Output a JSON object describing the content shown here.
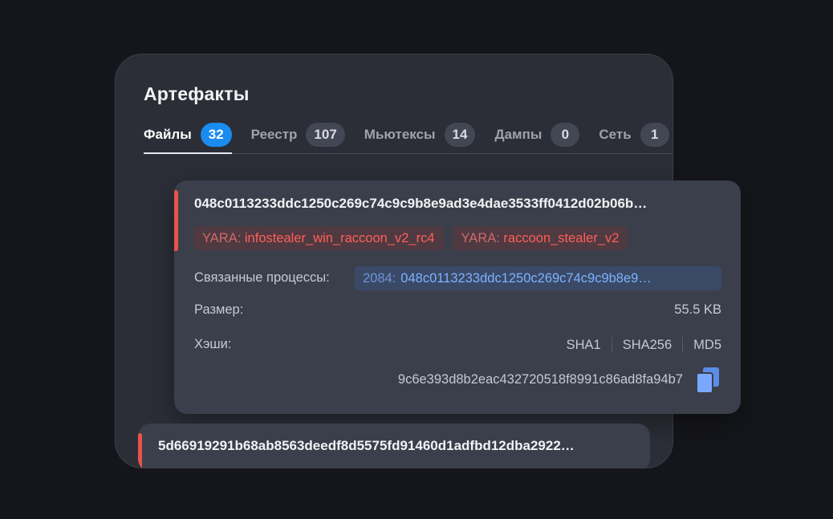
{
  "panel": {
    "title": "Артефакты",
    "tabs": [
      {
        "label": "Файлы",
        "count": "32",
        "active": true
      },
      {
        "label": "Реестр",
        "count": "107",
        "active": false
      },
      {
        "label": "Мьютексы",
        "count": "14",
        "active": false
      },
      {
        "label": "Дампы",
        "count": "0",
        "active": false
      },
      {
        "label": "Сеть",
        "count": "1",
        "active": false
      }
    ]
  },
  "file_card": {
    "hash": "048c0113233ddc1250c269c74c9c9b8e9ad3e4dae3533ff0412d02b06b…",
    "tags": [
      {
        "prefix": "YARA:",
        "name": "infostealer_win_raccoon_v2_rc4"
      },
      {
        "prefix": "YARA:",
        "name": "raccoon_stealer_v2"
      }
    ],
    "related_label": "Связанные процессы:",
    "process": {
      "pid": "2084:",
      "name": "048c0113233ddc1250c269c74c9c9b8e9…"
    },
    "size_label": "Размер:",
    "size_value": "55.5 KB",
    "hashes_label": "Хэши:",
    "hash_options": [
      "SHA1",
      "SHA256",
      "MD5"
    ],
    "hash_value": "9c6e393d8b2eac432720518f8991c86ad8fa94b7",
    "copy_icon": "copy-icon",
    "accent_color": "#e8534b"
  },
  "second_file": {
    "hash": "5d66919291b68ab8563deedf8d5575fd91460d1adfbd12dba2922…"
  }
}
